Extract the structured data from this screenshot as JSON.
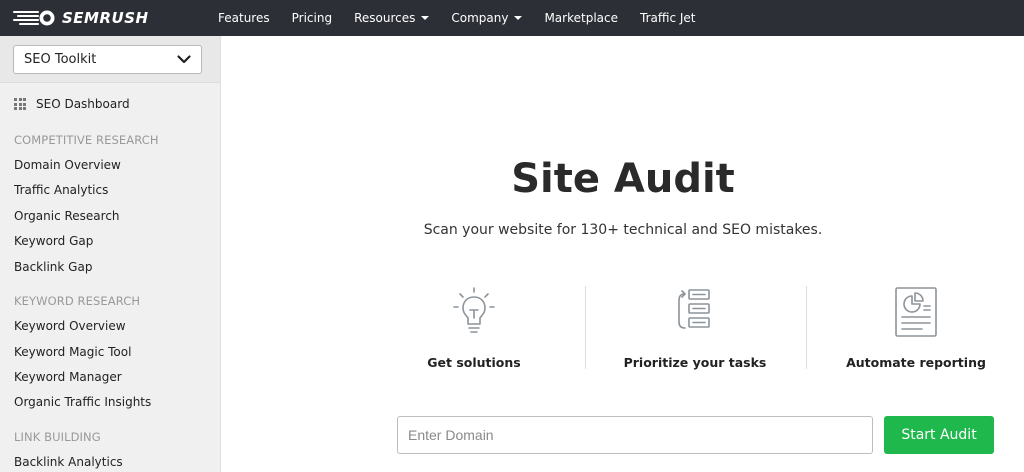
{
  "brand": {
    "logo_text": "SEMRUSH",
    "colors": {
      "topbar": "#2c2f36",
      "accent": "#1fb84c",
      "logo": "#ffffff"
    }
  },
  "nav": [
    {
      "label": "Features",
      "dropdown": false
    },
    {
      "label": "Pricing",
      "dropdown": false
    },
    {
      "label": "Resources",
      "dropdown": true
    },
    {
      "label": "Company",
      "dropdown": true
    },
    {
      "label": "Marketplace",
      "dropdown": false
    },
    {
      "label": "Traffic Jet",
      "dropdown": false
    }
  ],
  "sidebar": {
    "toolkit_select": {
      "value": "SEO Toolkit",
      "icon": "chevron-down-icon"
    },
    "dashboard": {
      "label": "SEO Dashboard",
      "icon": "grid-icon"
    },
    "sections": [
      {
        "heading": "COMPETITIVE RESEARCH",
        "items": [
          "Domain Overview",
          "Traffic Analytics",
          "Organic Research",
          "Keyword Gap",
          "Backlink Gap"
        ]
      },
      {
        "heading": "KEYWORD RESEARCH",
        "items": [
          "Keyword Overview",
          "Keyword Magic Tool",
          "Keyword Manager",
          "Organic Traffic Insights"
        ]
      },
      {
        "heading": "LINK BUILDING",
        "items": [
          "Backlink Analytics"
        ]
      }
    ]
  },
  "main": {
    "title": "Site Audit",
    "subtitle": "Scan your website for 130+ technical and SEO mistakes.",
    "features": [
      {
        "label": "Get solutions",
        "icon": "lightbulb-icon"
      },
      {
        "label": "Prioritize your tasks",
        "icon": "task-list-icon"
      },
      {
        "label": "Automate reporting",
        "icon": "report-icon"
      }
    ],
    "domain_input": {
      "placeholder": "Enter Domain",
      "value": ""
    },
    "start_button": "Start Audit"
  }
}
